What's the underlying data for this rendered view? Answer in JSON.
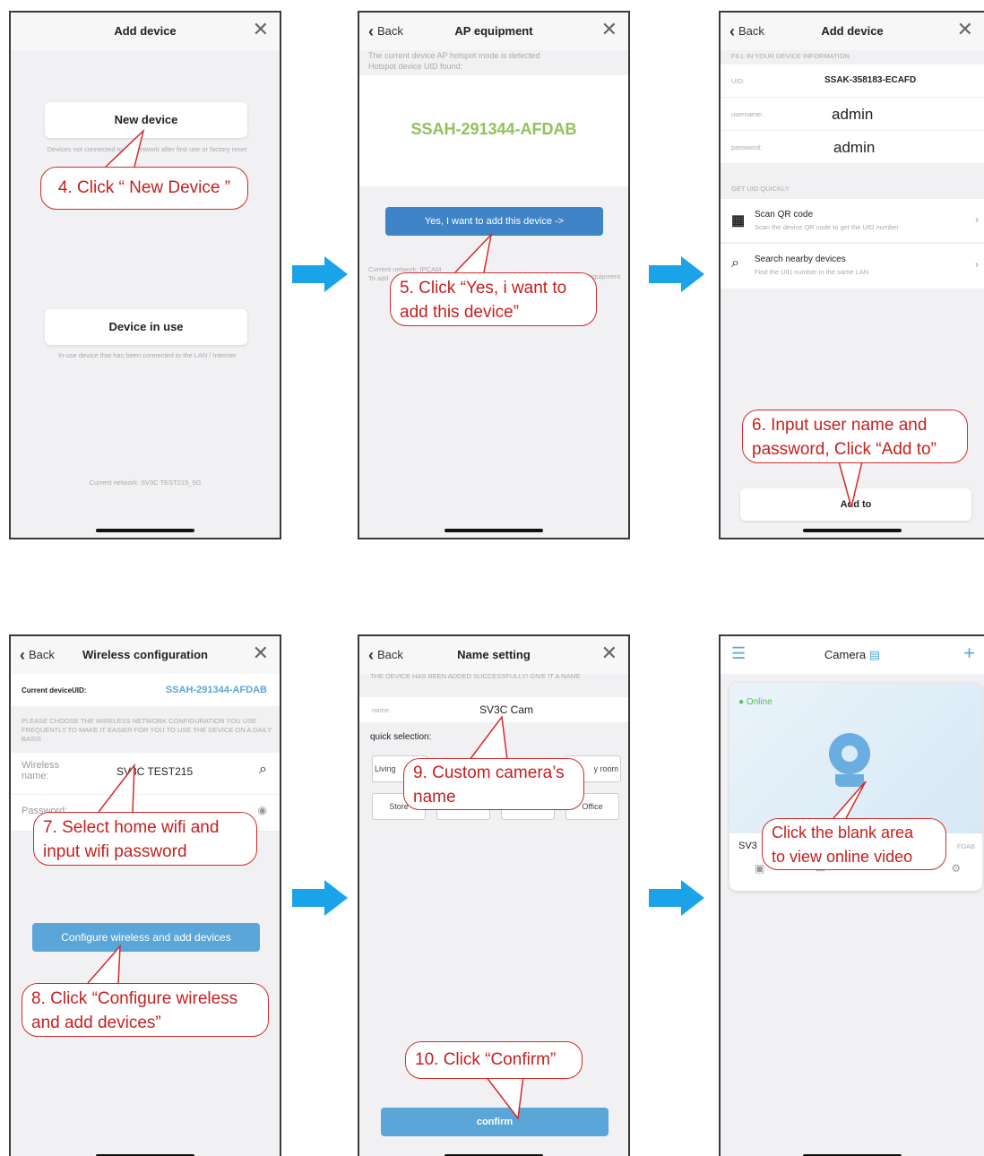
{
  "colors": {
    "blue_arrow": "#1aa3e8",
    "callout_red": "#c61f1f",
    "button_blue": "#3f84c6",
    "green_uid": "#8fc25a",
    "uid_blue": "#5aa6d8"
  },
  "screen1": {
    "title": "Add device",
    "new_device": "New device",
    "new_device_desc": "Devices not connected to the network after first use or factory reset",
    "in_use": "Device in use",
    "in_use_desc": "In-use device that has been connected to the LAN / Internet",
    "network": "Current network: SV3C TEST215_5G",
    "callout": "4. Click “ New Device ”"
  },
  "screen2": {
    "back": "Back",
    "title": "AP equipment",
    "info_line1": "The current device AP hotspot mode is detected",
    "info_line2": "Hotspot device UID found:",
    "uid": "SSAH-291344-AFDAB",
    "button": "Yes, I want to add this device ->",
    "network_line1": "Current network: IPCAM",
    "network_line2": "To add",
    "network_line3": "equipment",
    "callout_line1": "5. Click “Yes, i want to",
    "callout_line2": "add this device”"
  },
  "screen3": {
    "back": "Back",
    "title": "Add device",
    "section1": "FILL IN YOUR DEVICE INFORMATION",
    "uid_label": "UID:",
    "uid_value": "SSAK-358183-ECAFD",
    "username_label": "username:",
    "username_value": "admin",
    "password_label": "password:",
    "password_value": "admin",
    "section2": "GET UID QUICKLY",
    "scan_title": "Scan QR code",
    "scan_desc": "Scan the device QR code to get the UID number",
    "search_title": "Search nearby devices",
    "search_desc": "Find the UID number in the same LAN",
    "add_button": "Add to",
    "callout_line1": "6. Input user name and",
    "callout_line2": "password, Click “Add to”"
  },
  "screen4": {
    "back": "Back",
    "title": "Wireless configuration",
    "uid_label": "Current deviceUID:",
    "uid_value": "SSAH-291344-AFDAB",
    "hint": "PLEASE CHOOSE THE WIRELESS NETWORK CONFIGURATION YOU USE FREQUENTLY TO MAKE IT EASIER FOR YOU TO USE THE DEVICE ON A DAILY BASIS",
    "wireless_label": "Wireless name:",
    "wireless_value": "SV3C TEST215",
    "password_label": "Password:",
    "button": "Configure wireless and add devices",
    "callout7_line1": "7. Select home wifi and",
    "callout7_line2": "input wifi password",
    "callout8_line1": "8. Click “Configure wireless",
    "callout8_line2": "and add devices”"
  },
  "screen5": {
    "back": "Back",
    "title": "Name setting",
    "hint": "THE DEVICE HAS BEEN ADDED SUCCESSFULLY! GIVE IT A NAME",
    "name_label": "name:",
    "name_value": "SV3C Cam",
    "quick": "quick selection:",
    "chip_living": "Living",
    "chip_room": "y room",
    "chip_store": "Store",
    "chip_office": "Office",
    "button": "confirm",
    "callout9_line1": "9. Custom camera’s",
    "callout9_line2": "name",
    "callout10": "10. Click “Confirm”"
  },
  "screen6": {
    "title": "Camera",
    "online": "Online",
    "cam_name": "SV3",
    "cam_uid": "FDAB",
    "callout_line1": "Click the blank area",
    "callout_line2": "to view online video"
  }
}
